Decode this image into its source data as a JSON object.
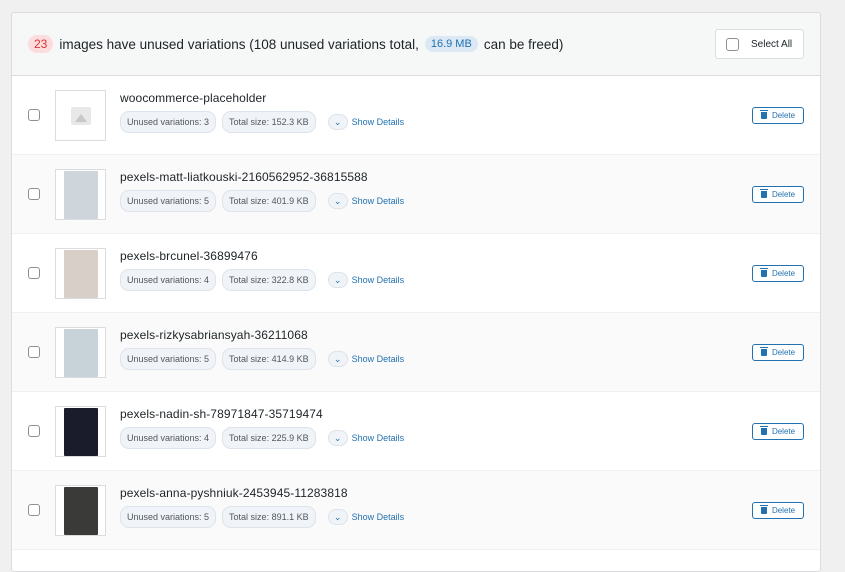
{
  "header": {
    "count": "23",
    "text_before": "images have unused variations (108 unused variations total,",
    "size": "16.9 MB",
    "text_after": "can be freed)",
    "select_all_label": "Select All"
  },
  "rows": [
    {
      "name": "woocommerce-placeholder",
      "unused": "Unused variations: 3",
      "total": "Total size: 152.3 KB",
      "details": "Show Details",
      "delete": "Delete",
      "thumb_color": "#e8e8e8"
    },
    {
      "name": "pexels-matt-liatkouski-2160562952-36815588",
      "unused": "Unused variations: 5",
      "total": "Total size: 401.9 KB",
      "details": "Show Details",
      "delete": "Delete",
      "thumb_color": "#cfd6db"
    },
    {
      "name": "pexels-brcunel-36899476",
      "unused": "Unused variations: 4",
      "total": "Total size: 322.8 KB",
      "details": "Show Details",
      "delete": "Delete",
      "thumb_color": "#d9cfc9"
    },
    {
      "name": "pexels-rizkysabriansyah-36211068",
      "unused": "Unused variations: 5",
      "total": "Total size: 414.9 KB",
      "details": "Show Details",
      "delete": "Delete",
      "thumb_color": "#c8d2d9"
    },
    {
      "name": "pexels-nadin-sh-78971847-35719474",
      "unused": "Unused variations: 4",
      "total": "Total size: 225.9 KB",
      "details": "Show Details",
      "delete": "Delete",
      "thumb_color": "#1a1c2c"
    },
    {
      "name": "pexels-anna-pyshniuk-2453945-11283818",
      "unused": "Unused variations: 5",
      "total": "Total size: 891.1 KB",
      "details": "Show Details",
      "delete": "Delete",
      "thumb_color": "#3a3a38"
    }
  ]
}
